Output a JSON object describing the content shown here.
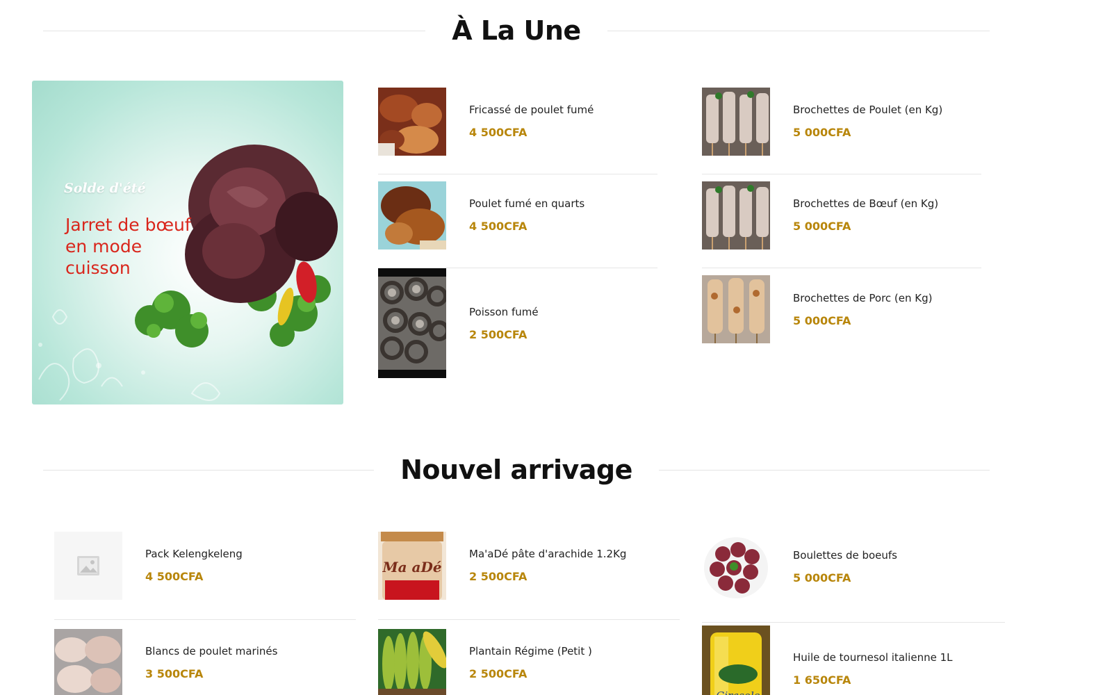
{
  "sections": {
    "featured_title": "À La Une",
    "new_title": "Nouvel arrivage"
  },
  "promo": {
    "kicker": "Solde d'été",
    "headline": "Jarret de bœuf en mode cuisson"
  },
  "featured": {
    "left": [
      {
        "name": "Fricassé de poulet fumé",
        "price": "4 500CFA",
        "icon": "fried-chicken-photo"
      },
      {
        "name": "Poulet fumé en quarts",
        "price": "4 500CFA",
        "icon": "smoked-chicken-photo"
      },
      {
        "name": "Poisson fumé",
        "price": "2 500CFA",
        "icon": "smoked-fish-photo"
      }
    ],
    "right": [
      {
        "name": "Brochettes de Poulet (en Kg)",
        "price": "5 000CFA",
        "icon": "skewers-photo"
      },
      {
        "name": "Brochettes de Bœuf (en Kg)",
        "price": "5 000CFA",
        "icon": "skewers-photo"
      },
      {
        "name": "Brochettes de Porc (en Kg)",
        "price": "5 000CFA",
        "icon": "grilled-skewers-photo"
      }
    ]
  },
  "new_arrivals": {
    "col1": [
      {
        "name": "Pack Kelengkeleng",
        "price": "4 500CFA",
        "icon": "image-placeholder-icon"
      },
      {
        "name": "Blancs de poulet marinés",
        "price": "3 500CFA",
        "icon": "chicken-breast-photo"
      }
    ],
    "col2": [
      {
        "name": "Ma'aDé pâte d'arachide 1.2Kg",
        "price": "2 500CFA",
        "icon": "peanut-paste-jar-photo",
        "brand": "Ma aDé"
      },
      {
        "name": "Plantain Régime (Petit )",
        "price": "2 500CFA",
        "icon": "plantain-photo"
      }
    ],
    "col3": [
      {
        "name": "Boulettes de boeufs",
        "price": "5 000CFA",
        "icon": "meatballs-photo"
      },
      {
        "name": "Huile de tournesol italienne 1L",
        "price": "1 650CFA",
        "icon": "sunflower-oil-photo",
        "brand": "Girasole"
      }
    ]
  },
  "colors": {
    "price": "#b8860b",
    "promo_headline": "#d9261c",
    "promo_bg": "#a4dccd"
  }
}
